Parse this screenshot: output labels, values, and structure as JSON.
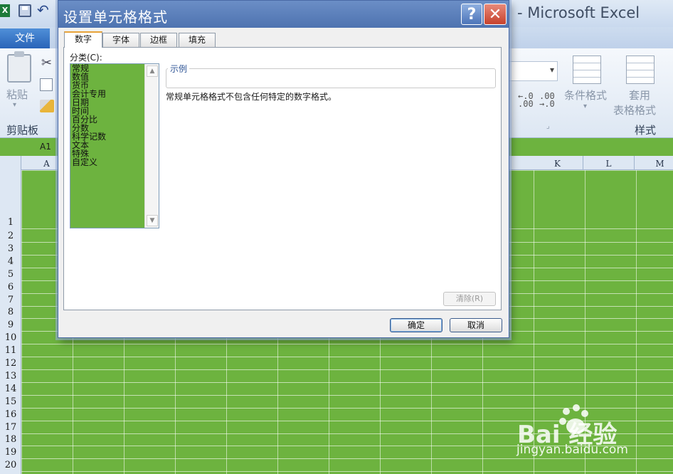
{
  "app": {
    "icon_text": "X",
    "title_suffix": "- Microsoft Excel",
    "file_tab": "文件"
  },
  "ribbon": {
    "paste_label": "粘贴",
    "clipboard_group": "剪贴板",
    "conditional_format": "条件格式",
    "apply_label": "套用",
    "table_format": "表格格式",
    "styles_group": "样式",
    "inc_decimal": "←.0\n.00",
    "dec_decimal": ".00\n→.0"
  },
  "name_box": "A1",
  "columns": [
    "A",
    "K",
    "L",
    "M"
  ],
  "rows": [
    "1",
    "2",
    "3",
    "4",
    "5",
    "6",
    "7",
    "8",
    "9",
    "10",
    "11",
    "12",
    "13",
    "14",
    "15",
    "16",
    "17",
    "18",
    "19",
    "20"
  ],
  "dialog": {
    "title": "设置单元格格式",
    "help": "?",
    "close": "✕",
    "tabs": [
      "数字",
      "字体",
      "边框",
      "填充"
    ],
    "category_label": "分类(C):",
    "categories": [
      "常规",
      "数值",
      "货币",
      "会计专用",
      "日期",
      "时间",
      "百分比",
      "分数",
      "科学记数",
      "文本",
      "特殊",
      "自定义"
    ],
    "sample_label": "示例",
    "description": "常规单元格格式不包含任何特定的数字格式。",
    "clear_button": "清除(R)",
    "ok_button": "确定",
    "cancel_button": "取消"
  },
  "watermark": {
    "brand": "Bai  经验",
    "url": "jingyan.baidu.com"
  },
  "colors": {
    "sheet_fill": "#6db33f",
    "dialog_title": "#4e73b0",
    "close_red": "#c5412c"
  }
}
